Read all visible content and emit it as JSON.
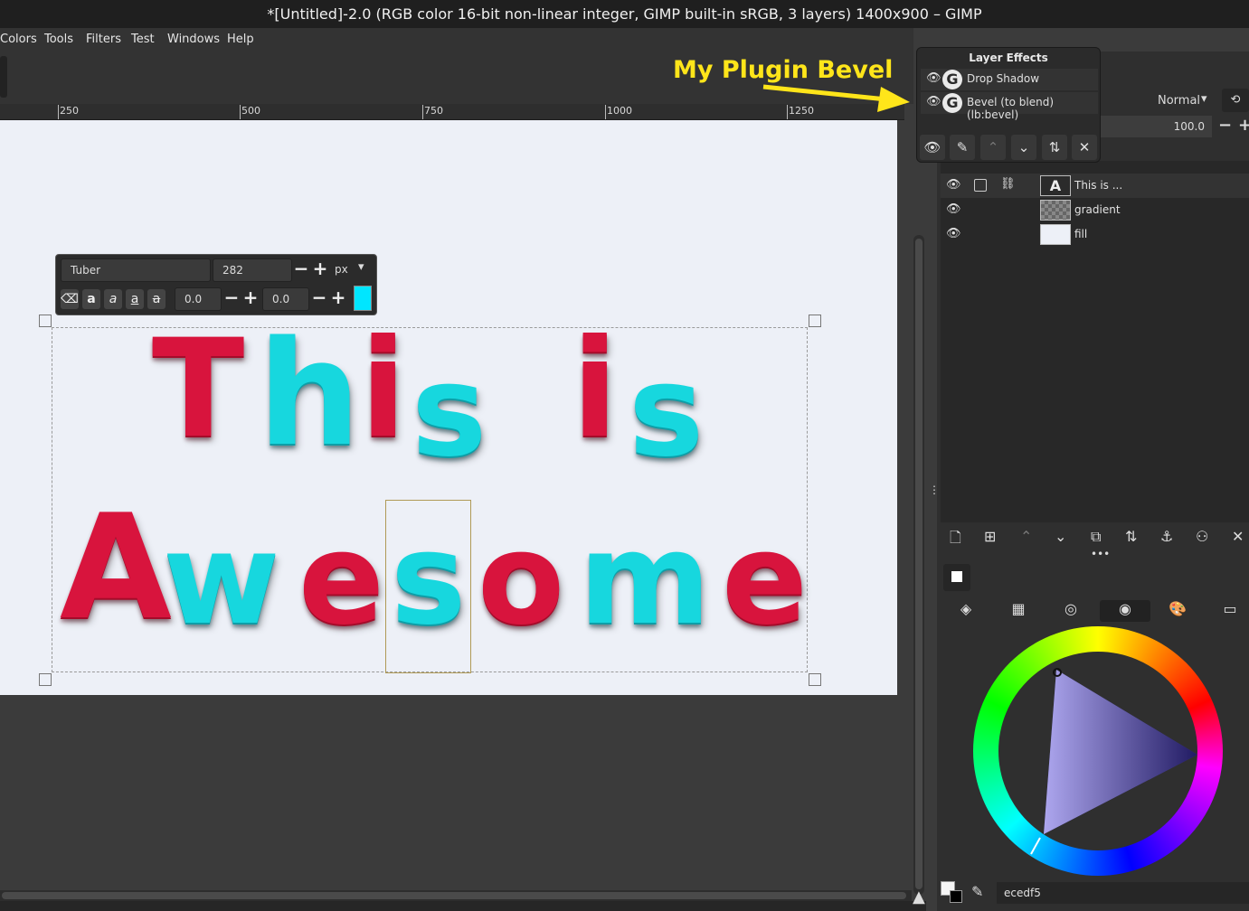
{
  "window": {
    "title": "*[Untitled]-2.0 (RGB color 16-bit non-linear integer, GIMP built-in sRGB, 3 layers) 1400x900 – GIMP"
  },
  "menu": [
    "Colors",
    "Tools",
    "Filters",
    "Test",
    "Windows",
    "Help"
  ],
  "ruler": {
    "labels": [
      "250",
      "500",
      "750",
      "1000",
      "1250"
    ]
  },
  "canvas": {
    "line1": [
      {
        "text": "T",
        "color": "red"
      },
      {
        "text": "h",
        "color": "cyan"
      },
      {
        "text": "i",
        "color": "red"
      },
      {
        "text": "s",
        "color": "cyan"
      },
      {
        "text": "i",
        "color": "red"
      },
      {
        "text": "s",
        "color": "cyan"
      }
    ],
    "line2": [
      {
        "text": "A",
        "color": "red"
      },
      {
        "text": "w",
        "color": "cyan"
      },
      {
        "text": "e",
        "color": "red"
      },
      {
        "text": "s",
        "color": "cyan"
      },
      {
        "text": "o",
        "color": "red"
      },
      {
        "text": "m",
        "color": "cyan"
      },
      {
        "text": "e",
        "color": "red"
      }
    ],
    "colors": {
      "red": "#d8143d",
      "cyan": "#17d7de",
      "background": "#edf0f7"
    }
  },
  "text_toolbar": {
    "font": "Tuber",
    "size": "282",
    "unit": "px",
    "baseline": "0.0",
    "kerning": "0.0",
    "color": "#00e6ff"
  },
  "effects_popup": {
    "title": "Layer Effects",
    "items": [
      {
        "name": "Drop Shadow",
        "icon": "gegl-icon"
      },
      {
        "name": "Bevel (to blend) (lb:bevel)",
        "icon": "gegl-icon"
      }
    ]
  },
  "annotation": {
    "text": "My Plugin Bevel",
    "color": "#ffe51a"
  },
  "layers_panel": {
    "mode": "Normal",
    "opacity": "100.0",
    "layers": [
      {
        "name": "This is ...",
        "thumb": "text-icon"
      },
      {
        "name": "gradient",
        "thumb": "checker"
      },
      {
        "name": "fill",
        "thumb": "fill"
      }
    ]
  },
  "colors_panel": {
    "hex": "ecedf5"
  }
}
